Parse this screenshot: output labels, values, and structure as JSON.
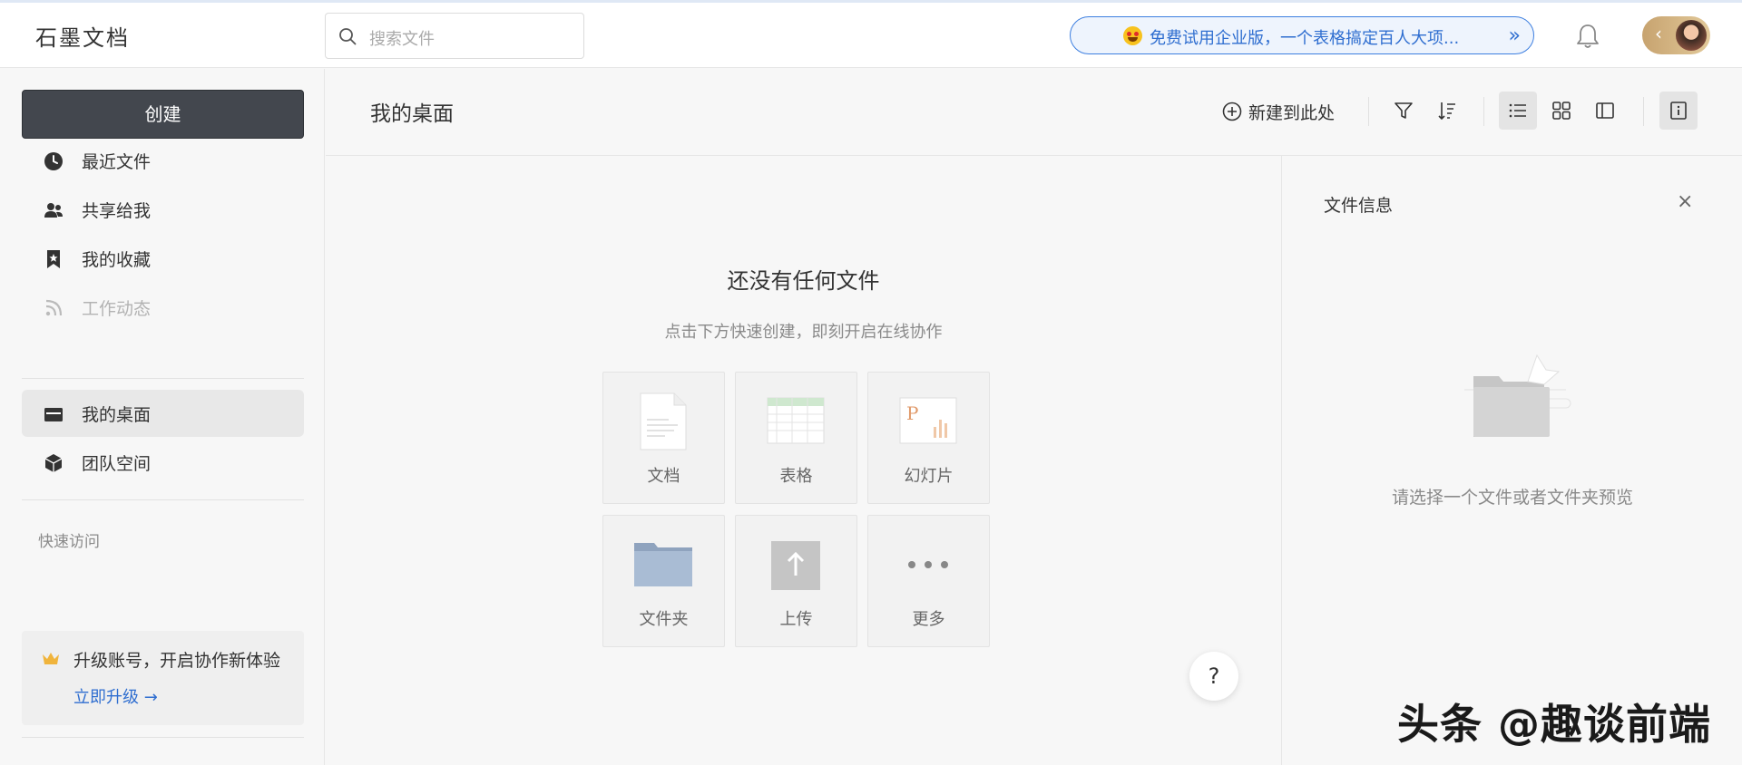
{
  "app": {
    "logo": "石墨文档"
  },
  "header": {
    "search_placeholder": "搜索文件",
    "promo_text": "免费试用企业版，一个表格搞定百人大项...",
    "promo_chevron": "»",
    "avatar_chevron": "‹"
  },
  "sidebar": {
    "create_label": "创建",
    "items": [
      {
        "label": "最近文件",
        "icon": "clock-icon"
      },
      {
        "label": "共享给我",
        "icon": "people-icon"
      },
      {
        "label": "我的收藏",
        "icon": "bookmark-star-icon"
      },
      {
        "label": "工作动态",
        "icon": "rss-icon",
        "disabled": true
      },
      {
        "label": "我的桌面",
        "icon": "desktop-icon",
        "active": true
      },
      {
        "label": "团队空间",
        "icon": "cube-icon"
      }
    ],
    "quick_access": "快速访问",
    "upgrade": {
      "text": "升级账号，开启协作新体验",
      "link": "立即升级 →"
    }
  },
  "toolbar": {
    "title": "我的桌面",
    "new_here": "新建到此处",
    "view_selected": "list"
  },
  "main": {
    "empty_title": "还没有任何文件",
    "empty_subtitle": "点击下方快速创建，即刻开启在线协作",
    "tiles": [
      {
        "label": "文档",
        "icon": "document-icon"
      },
      {
        "label": "表格",
        "icon": "spreadsheet-icon"
      },
      {
        "label": "幻灯片",
        "icon": "slides-icon"
      },
      {
        "label": "文件夹",
        "icon": "folder-icon"
      },
      {
        "label": "上传",
        "icon": "upload-icon"
      },
      {
        "label": "更多",
        "icon": "more-icon"
      }
    ],
    "help": "?"
  },
  "info_panel": {
    "title": "文件信息",
    "close": "×",
    "empty_text": "请选择一个文件或者文件夹预览"
  },
  "watermark": "头条 @趣谈前端",
  "colors": {
    "accent": "#2f6ed0",
    "create_button": "#43474e"
  }
}
